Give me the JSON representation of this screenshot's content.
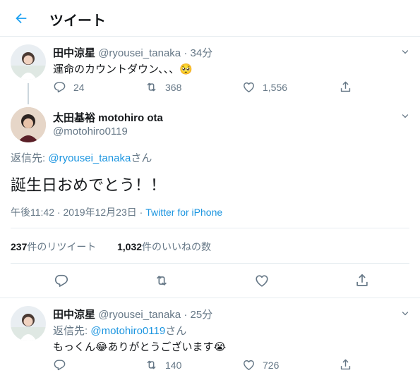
{
  "header": {
    "title": "ツイート"
  },
  "tweet1": {
    "name": "田中涼星",
    "handle": "@ryousei_tanaka",
    "sep": "·",
    "time": "34分",
    "text": "運命のカウントダウン、、、",
    "emoji": "🥺",
    "replies": "24",
    "retweets": "368",
    "likes": "1,556"
  },
  "main": {
    "name": "太田基裕 motohiro ota",
    "handle": "@motohiro0119",
    "reply_prefix": "返信先: ",
    "reply_to": "@ryousei_tanaka",
    "reply_suffix": "さん",
    "text": "誕生日おめでとう！！",
    "time": "午後11:42",
    "sep1": " · ",
    "date": "2019年12月23日",
    "sep2": " · ",
    "source": "Twitter for iPhone",
    "retweet_count": "237",
    "retweet_label": "件のリツイート",
    "like_count": "1,032",
    "like_label": "件のいいねの数"
  },
  "tweet2": {
    "name": "田中涼星",
    "handle": "@ryousei_tanaka",
    "sep": "·",
    "time": "25分",
    "reply_prefix": "返信先: ",
    "reply_to": "@motohiro0119",
    "reply_suffix": "さん",
    "text_a": "もっくん",
    "emoji_a": "😂",
    "text_b": "ありがとうございます",
    "emoji_b": "😭",
    "retweets": "140",
    "likes": "726"
  },
  "colors": {
    "accent": "#1da1f2",
    "link": "#1b95e0",
    "muted": "#657786",
    "border": "#e6ecf0"
  },
  "icons": [
    "back-arrow-icon",
    "chevron-down-icon",
    "reply-icon",
    "retweet-icon",
    "like-icon",
    "share-icon"
  ]
}
